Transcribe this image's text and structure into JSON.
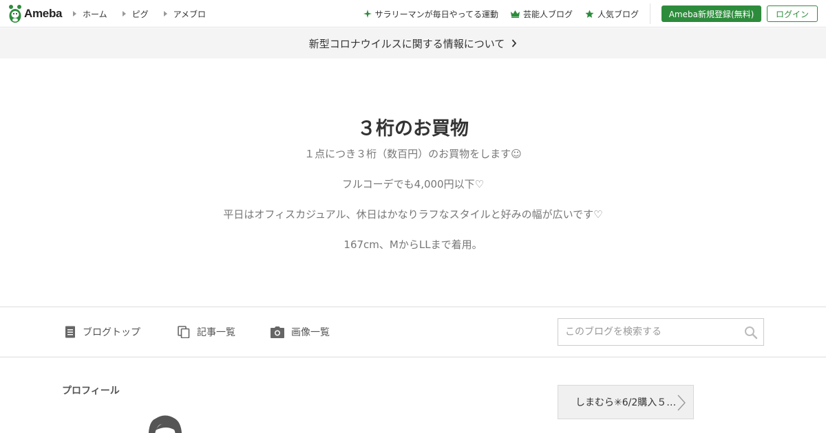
{
  "header": {
    "logo_text": "Ameba",
    "nav_left": [
      "ホーム",
      "ピグ",
      "アメブロ"
    ],
    "nav_right": [
      {
        "label": "サラリーマンが毎日やってる運動",
        "icon": "sparkle-icon"
      },
      {
        "label": "芸能人ブログ",
        "icon": "crown-icon"
      },
      {
        "label": "人気ブログ",
        "icon": "star-icon"
      }
    ],
    "register_label": "Ameba新規登録(無料)",
    "login_label": "ログイン"
  },
  "notice": {
    "text": "新型コロナウイルスに関する情報について"
  },
  "blog": {
    "title": "３桁のお買物",
    "description": [
      "１点につき３桁（数百円）のお買物をします☺",
      "フルコーデでも4,000円以下♡",
      "平日はオフィスカジュアル、休日はかなりラフなスタイルと好みの幅が広いです♡",
      "167cm、MからLLまで着用。"
    ]
  },
  "blog_nav": {
    "items": [
      {
        "label": "ブログトップ",
        "icon": "document-icon"
      },
      {
        "label": "記事一覧",
        "icon": "copy-icon"
      },
      {
        "label": "画像一覧",
        "icon": "camera-icon"
      }
    ],
    "search_placeholder": "このブログを検索する"
  },
  "profile": {
    "heading": "プロフィール"
  },
  "next_entry": {
    "label": "しまむら✳6/2購入５…"
  },
  "colors": {
    "brand_green": "#2d8c3c",
    "notice_bg": "#f4f4f4"
  }
}
